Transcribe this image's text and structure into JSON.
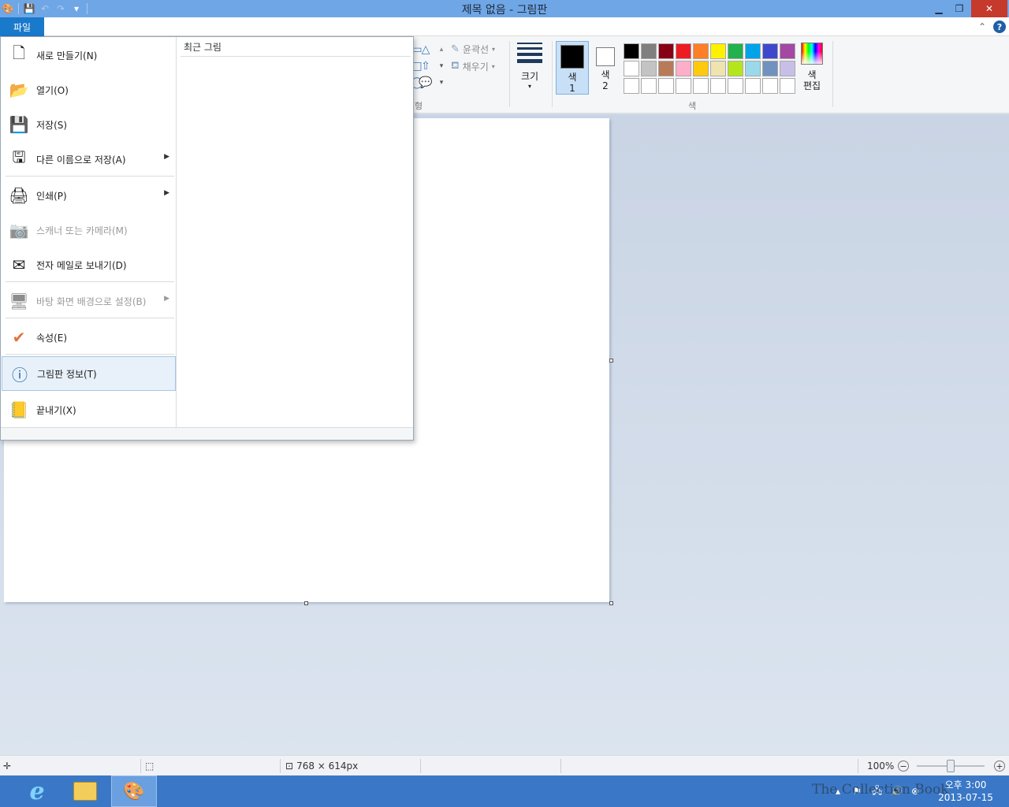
{
  "window": {
    "title": "제목 없음 - 그림판"
  },
  "quick_access": {
    "app_icon": "paint-app-icon",
    "save_icon": "save-icon",
    "undo_icon": "undo-icon",
    "redo_icon": "redo-icon",
    "customize_icon": "customize-icon"
  },
  "ribbon": {
    "file_tab_label": "파일",
    "shapes_group_label": "형",
    "outline_label": "윤곽선",
    "fill_label": "채우기",
    "size_label": "크기",
    "color1_label_line1": "색",
    "color1_label_line2": "1",
    "color2_label_line1": "색",
    "color2_label_line2": "2",
    "colors_group_label": "색",
    "edit_colors_line1": "색",
    "edit_colors_line2": "편집",
    "color1_value": "#000000",
    "color2_value": "#ffffff",
    "palette": [
      "#000000",
      "#7f7f7f",
      "#880015",
      "#ed1c24",
      "#ff7f27",
      "#fff200",
      "#22b14c",
      "#00a2e8",
      "#3f48cc",
      "#a349a4",
      "#ffffff",
      "#c3c3c3",
      "#b97a57",
      "#ffaec9",
      "#ffc90e",
      "#efe4b0",
      "#b5e61d",
      "#99d9ea",
      "#7092be",
      "#c8bfe7",
      "#ffffff",
      "#ffffff",
      "#ffffff",
      "#ffffff",
      "#ffffff",
      "#ffffff",
      "#ffffff",
      "#ffffff",
      "#ffffff",
      "#ffffff"
    ]
  },
  "file_menu": {
    "items": [
      {
        "label": "새로 만들기(N)",
        "icon": "new-document-icon",
        "disabled": false,
        "submenu": false
      },
      {
        "label": "열기(O)",
        "icon": "open-folder-icon",
        "disabled": false,
        "submenu": false
      },
      {
        "label": "저장(S)",
        "icon": "save-icon",
        "disabled": false,
        "submenu": false
      },
      {
        "label": "다른 이름으로 저장(A)",
        "icon": "save-as-icon",
        "disabled": false,
        "submenu": true
      },
      {
        "label": "인쇄(P)",
        "icon": "printer-icon",
        "disabled": false,
        "submenu": true
      },
      {
        "label": "스캐너 또는 카메라(M)",
        "icon": "scanner-icon",
        "disabled": true,
        "submenu": false
      },
      {
        "label": "전자 메일로 보내기(D)",
        "icon": "email-icon",
        "disabled": false,
        "submenu": false
      },
      {
        "label": "바탕 화면 배경으로 설정(B)",
        "icon": "desktop-background-icon",
        "disabled": true,
        "submenu": true
      },
      {
        "label": "속성(E)",
        "icon": "checkmark-icon",
        "disabled": false,
        "submenu": false
      },
      {
        "label": "그림판 정보(T)",
        "icon": "info-icon",
        "disabled": false,
        "submenu": false
      },
      {
        "label": "끝내기(X)",
        "icon": "exit-icon",
        "disabled": false,
        "submenu": false
      }
    ],
    "recent_heading": "최근 그림"
  },
  "status": {
    "canvas_size": "768 × 614px",
    "zoom": "100%",
    "zoom_level": 0.5
  },
  "taskbar": {
    "clock_time": "오후 3:00",
    "clock_date": "2013-07-15"
  },
  "watermark": "The Collection Book"
}
